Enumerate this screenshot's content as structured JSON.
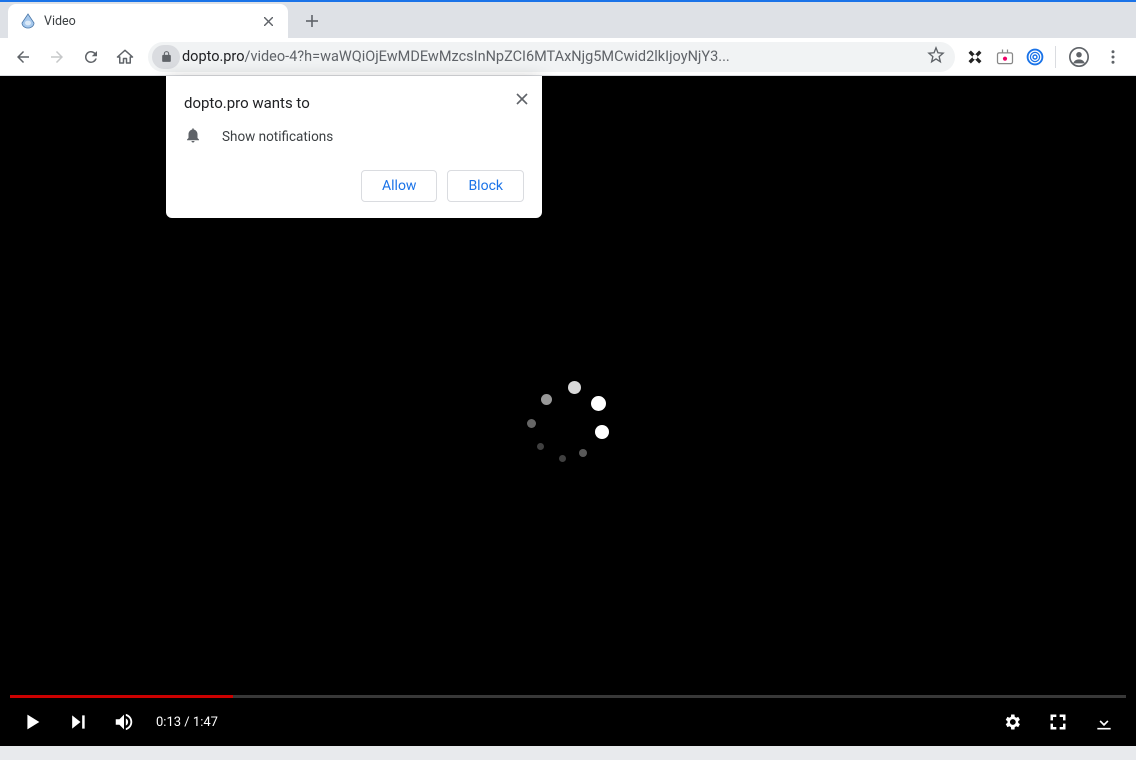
{
  "tab": {
    "title": "Video"
  },
  "omnibox": {
    "domain": "dopto.pro",
    "path": "/video-4?h=waWQiOjEwMDEwMzcsInNpZCI6MTAxNjg5MCwid2lkIjoyNjY3..."
  },
  "permission": {
    "title": "dopto.pro wants to",
    "request": "Show notifications",
    "allow": "Allow",
    "block": "Block"
  },
  "player": {
    "current": "0:13",
    "separator": " / ",
    "total": "1:47",
    "progress_percent": 20
  }
}
